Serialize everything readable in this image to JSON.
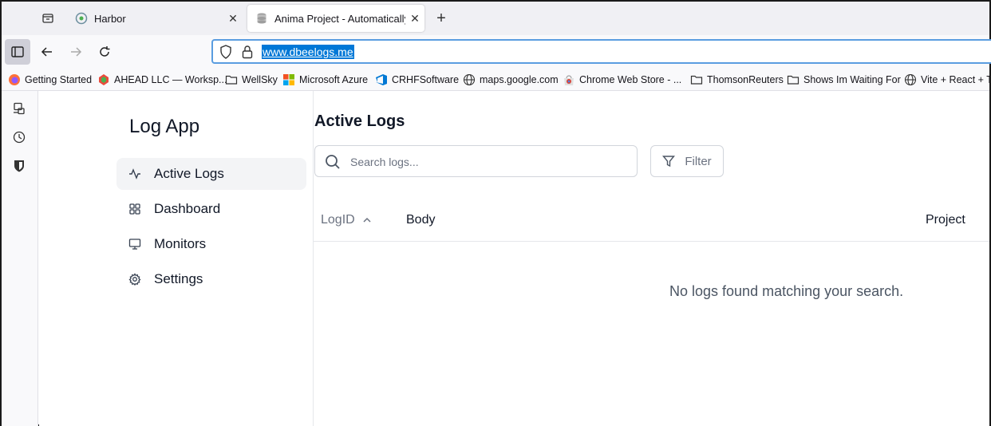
{
  "browser": {
    "tabs": [
      {
        "title": "Harbor",
        "icon": "harbor-favicon",
        "close": "✕"
      },
      {
        "title": "Anima Project - Automatically generated",
        "icon": "database-favicon",
        "close": "✕",
        "active": true
      }
    ],
    "new_tab": "+",
    "url": "www.dbeelogs.me",
    "accent_color": "#0078d7"
  },
  "bookmarks": [
    {
      "label": "Getting Started",
      "icon": "firefox-icon"
    },
    {
      "label": "AHEAD LLC — Worksp...",
      "icon": "ahead-icon"
    },
    {
      "label": "WellSky",
      "icon": "folder-icon"
    },
    {
      "label": "Microsoft Azure",
      "icon": "microsoft-icon"
    },
    {
      "label": "CRHFSoftware",
      "icon": "azure-devops-icon"
    },
    {
      "label": "maps.google.com",
      "icon": "globe-icon"
    },
    {
      "label": "Chrome Web Store - ...",
      "icon": "chrome-store-icon"
    },
    {
      "label": "ThomsonReuters",
      "icon": "folder-icon"
    },
    {
      "label": "Shows Im Waiting For",
      "icon": "folder-icon"
    },
    {
      "label": "Vite + React + TS",
      "icon": "globe-icon"
    }
  ],
  "app": {
    "title": "Log App",
    "nav": [
      {
        "label": "Active Logs",
        "icon": "activity-icon",
        "active": true
      },
      {
        "label": "Dashboard",
        "icon": "grid-icon"
      },
      {
        "label": "Monitors",
        "icon": "monitor-icon"
      },
      {
        "label": "Settings",
        "icon": "gear-icon"
      }
    ]
  },
  "main": {
    "title": "Active Logs",
    "search_placeholder": "Search logs...",
    "search_value": "",
    "filter_label": "Filter",
    "columns": [
      "LogID",
      "Body",
      "Project"
    ],
    "empty_message": "No logs found matching your search."
  }
}
